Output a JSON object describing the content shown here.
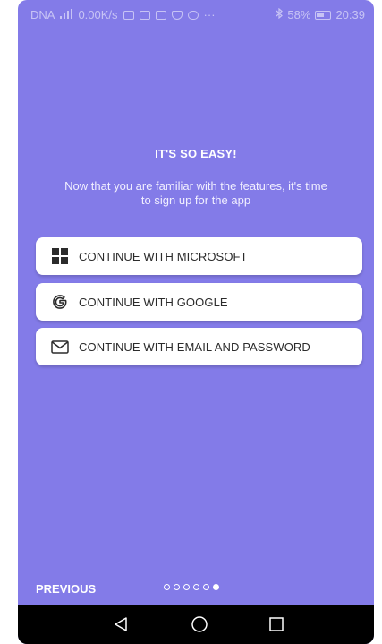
{
  "status_bar": {
    "carrier": "DNA",
    "network_speed": "0.00K/s",
    "more": "···",
    "battery_percent": "58%",
    "time": "20:39"
  },
  "onboarding": {
    "heading": "IT'S SO EASY!",
    "subtitle": "Now that you are familiar with the features, it's time to sign up for the app"
  },
  "buttons": {
    "microsoft": "CONTINUE WITH MICROSOFT",
    "google": "CONTINUE WITH GOOGLE",
    "email": "CONTINUE WITH EMAIL AND PASSWORD"
  },
  "footer": {
    "previous": "PREVIOUS",
    "page_count": 6,
    "current_page": 6
  },
  "icons": {
    "microsoft": "microsoft-logo-icon",
    "google": "google-g-icon",
    "email": "envelope-icon",
    "back": "back-triangle-icon",
    "home": "home-circle-icon",
    "recents": "recents-square-icon"
  },
  "colors": {
    "background": "#837be8",
    "button": "#ffffff",
    "nav_bar": "#000000"
  }
}
